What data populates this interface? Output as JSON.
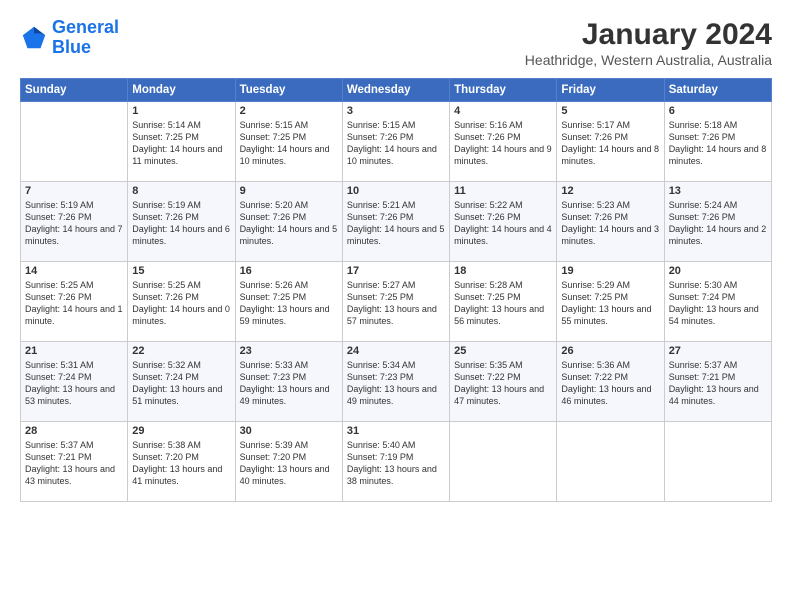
{
  "logo": {
    "line1": "General",
    "line2": "Blue"
  },
  "title": "January 2024",
  "subtitle": "Heathridge, Western Australia, Australia",
  "weekdays": [
    "Sunday",
    "Monday",
    "Tuesday",
    "Wednesday",
    "Thursday",
    "Friday",
    "Saturday"
  ],
  "weeks": [
    [
      {
        "day": "",
        "sunrise": "",
        "sunset": "",
        "daylight": ""
      },
      {
        "day": "1",
        "sunrise": "Sunrise: 5:14 AM",
        "sunset": "Sunset: 7:25 PM",
        "daylight": "Daylight: 14 hours and 11 minutes."
      },
      {
        "day": "2",
        "sunrise": "Sunrise: 5:15 AM",
        "sunset": "Sunset: 7:25 PM",
        "daylight": "Daylight: 14 hours and 10 minutes."
      },
      {
        "day": "3",
        "sunrise": "Sunrise: 5:15 AM",
        "sunset": "Sunset: 7:26 PM",
        "daylight": "Daylight: 14 hours and 10 minutes."
      },
      {
        "day": "4",
        "sunrise": "Sunrise: 5:16 AM",
        "sunset": "Sunset: 7:26 PM",
        "daylight": "Daylight: 14 hours and 9 minutes."
      },
      {
        "day": "5",
        "sunrise": "Sunrise: 5:17 AM",
        "sunset": "Sunset: 7:26 PM",
        "daylight": "Daylight: 14 hours and 8 minutes."
      },
      {
        "day": "6",
        "sunrise": "Sunrise: 5:18 AM",
        "sunset": "Sunset: 7:26 PM",
        "daylight": "Daylight: 14 hours and 8 minutes."
      }
    ],
    [
      {
        "day": "7",
        "sunrise": "Sunrise: 5:19 AM",
        "sunset": "Sunset: 7:26 PM",
        "daylight": "Daylight: 14 hours and 7 minutes."
      },
      {
        "day": "8",
        "sunrise": "Sunrise: 5:19 AM",
        "sunset": "Sunset: 7:26 PM",
        "daylight": "Daylight: 14 hours and 6 minutes."
      },
      {
        "day": "9",
        "sunrise": "Sunrise: 5:20 AM",
        "sunset": "Sunset: 7:26 PM",
        "daylight": "Daylight: 14 hours and 5 minutes."
      },
      {
        "day": "10",
        "sunrise": "Sunrise: 5:21 AM",
        "sunset": "Sunset: 7:26 PM",
        "daylight": "Daylight: 14 hours and 5 minutes."
      },
      {
        "day": "11",
        "sunrise": "Sunrise: 5:22 AM",
        "sunset": "Sunset: 7:26 PM",
        "daylight": "Daylight: 14 hours and 4 minutes."
      },
      {
        "day": "12",
        "sunrise": "Sunrise: 5:23 AM",
        "sunset": "Sunset: 7:26 PM",
        "daylight": "Daylight: 14 hours and 3 minutes."
      },
      {
        "day": "13",
        "sunrise": "Sunrise: 5:24 AM",
        "sunset": "Sunset: 7:26 PM",
        "daylight": "Daylight: 14 hours and 2 minutes."
      }
    ],
    [
      {
        "day": "14",
        "sunrise": "Sunrise: 5:25 AM",
        "sunset": "Sunset: 7:26 PM",
        "daylight": "Daylight: 14 hours and 1 minute."
      },
      {
        "day": "15",
        "sunrise": "Sunrise: 5:25 AM",
        "sunset": "Sunset: 7:26 PM",
        "daylight": "Daylight: 14 hours and 0 minutes."
      },
      {
        "day": "16",
        "sunrise": "Sunrise: 5:26 AM",
        "sunset": "Sunset: 7:25 PM",
        "daylight": "Daylight: 13 hours and 59 minutes."
      },
      {
        "day": "17",
        "sunrise": "Sunrise: 5:27 AM",
        "sunset": "Sunset: 7:25 PM",
        "daylight": "Daylight: 13 hours and 57 minutes."
      },
      {
        "day": "18",
        "sunrise": "Sunrise: 5:28 AM",
        "sunset": "Sunset: 7:25 PM",
        "daylight": "Daylight: 13 hours and 56 minutes."
      },
      {
        "day": "19",
        "sunrise": "Sunrise: 5:29 AM",
        "sunset": "Sunset: 7:25 PM",
        "daylight": "Daylight: 13 hours and 55 minutes."
      },
      {
        "day": "20",
        "sunrise": "Sunrise: 5:30 AM",
        "sunset": "Sunset: 7:24 PM",
        "daylight": "Daylight: 13 hours and 54 minutes."
      }
    ],
    [
      {
        "day": "21",
        "sunrise": "Sunrise: 5:31 AM",
        "sunset": "Sunset: 7:24 PM",
        "daylight": "Daylight: 13 hours and 53 minutes."
      },
      {
        "day": "22",
        "sunrise": "Sunrise: 5:32 AM",
        "sunset": "Sunset: 7:24 PM",
        "daylight": "Daylight: 13 hours and 51 minutes."
      },
      {
        "day": "23",
        "sunrise": "Sunrise: 5:33 AM",
        "sunset": "Sunset: 7:23 PM",
        "daylight": "Daylight: 13 hours and 49 minutes."
      },
      {
        "day": "24",
        "sunrise": "Sunrise: 5:34 AM",
        "sunset": "Sunset: 7:23 PM",
        "daylight": "Daylight: 13 hours and 49 minutes."
      },
      {
        "day": "25",
        "sunrise": "Sunrise: 5:35 AM",
        "sunset": "Sunset: 7:22 PM",
        "daylight": "Daylight: 13 hours and 47 minutes."
      },
      {
        "day": "26",
        "sunrise": "Sunrise: 5:36 AM",
        "sunset": "Sunset: 7:22 PM",
        "daylight": "Daylight: 13 hours and 46 minutes."
      },
      {
        "day": "27",
        "sunrise": "Sunrise: 5:37 AM",
        "sunset": "Sunset: 7:21 PM",
        "daylight": "Daylight: 13 hours and 44 minutes."
      }
    ],
    [
      {
        "day": "28",
        "sunrise": "Sunrise: 5:37 AM",
        "sunset": "Sunset: 7:21 PM",
        "daylight": "Daylight: 13 hours and 43 minutes."
      },
      {
        "day": "29",
        "sunrise": "Sunrise: 5:38 AM",
        "sunset": "Sunset: 7:20 PM",
        "daylight": "Daylight: 13 hours and 41 minutes."
      },
      {
        "day": "30",
        "sunrise": "Sunrise: 5:39 AM",
        "sunset": "Sunset: 7:20 PM",
        "daylight": "Daylight: 13 hours and 40 minutes."
      },
      {
        "day": "31",
        "sunrise": "Sunrise: 5:40 AM",
        "sunset": "Sunset: 7:19 PM",
        "daylight": "Daylight: 13 hours and 38 minutes."
      },
      {
        "day": "",
        "sunrise": "",
        "sunset": "",
        "daylight": ""
      },
      {
        "day": "",
        "sunrise": "",
        "sunset": "",
        "daylight": ""
      },
      {
        "day": "",
        "sunrise": "",
        "sunset": "",
        "daylight": ""
      }
    ]
  ]
}
